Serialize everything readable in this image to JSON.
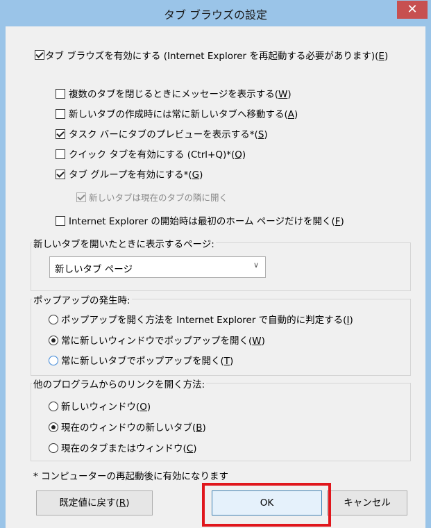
{
  "window": {
    "title": "タブ ブラウズの設定",
    "close_glyph": "✕"
  },
  "main_option": {
    "label": "タブ ブラウズを有効にする (Internet Explorer を再起動する必要があります)(",
    "accel": "E",
    "suffix": ")",
    "checked": true
  },
  "options": [
    {
      "label": "複数のタブを閉じるときにメッセージを表示する(",
      "accel": "W",
      "suffix": ")",
      "checked": false,
      "disabled": false
    },
    {
      "label": "新しいタブの作成時には常に新しいタブへ移動する(",
      "accel": "A",
      "suffix": ")",
      "checked": false,
      "disabled": false
    },
    {
      "label": "タスク バーにタブのプレビューを表示する*(",
      "accel": "S",
      "suffix": ")",
      "checked": true,
      "disabled": false
    },
    {
      "label": "クイック タブを有効にする (Ctrl+Q)*(",
      "accel": "Q",
      "suffix": ")",
      "checked": false,
      "disabled": false
    },
    {
      "label": "タブ グループを有効にする*(",
      "accel": "G",
      "suffix": ")",
      "checked": true,
      "disabled": false
    },
    {
      "label": "新しいタブは現在のタブの隣に開く",
      "accel": "",
      "suffix": "",
      "checked": true,
      "disabled": true
    },
    {
      "label": "Internet Explorer の開始時は最初のホーム ページだけを開く(",
      "accel": "F",
      "suffix": ")",
      "checked": false,
      "disabled": false
    }
  ],
  "newtab_group": {
    "title": "新しいタブを開いたときに表示するページ:",
    "selected": "新しいタブ ページ",
    "arrow_glyph": "∨"
  },
  "popup_group": {
    "title": "ポップアップの発生時:",
    "options": [
      {
        "label": "ポップアップを開く方法を Internet Explorer で自動的に判定する(",
        "accel": "I",
        "suffix": ")",
        "checked": false
      },
      {
        "label": "常に新しいウィンドウでポップアップを開く(",
        "accel": "W",
        "suffix": ")",
        "checked": true
      },
      {
        "label": "常に新しいタブでポップアップを開く(",
        "accel": "T",
        "suffix": ")",
        "checked": false
      }
    ]
  },
  "links_group": {
    "title": "他のプログラムからのリンクを開く方法:",
    "options": [
      {
        "label": "新しいウィンドウ(",
        "accel": "O",
        "suffix": ")",
        "checked": false
      },
      {
        "label": "現在のウィンドウの新しいタブ(",
        "accel": "B",
        "suffix": ")",
        "checked": true
      },
      {
        "label": "現在のタブまたはウィンドウ(",
        "accel": "C",
        "suffix": ")",
        "checked": false
      }
    ]
  },
  "footnote": "* コンピューターの再起動後に有効になります",
  "buttons": {
    "reset": {
      "label": "既定値に戻す(",
      "accel": "R",
      "suffix": ")"
    },
    "ok": {
      "label": "OK"
    },
    "cancel": {
      "label": "キャンセル"
    }
  },
  "colors": {
    "title_bar": "#9ac4e8",
    "close_button": "#c75050",
    "highlight_box": "#e0161c"
  }
}
